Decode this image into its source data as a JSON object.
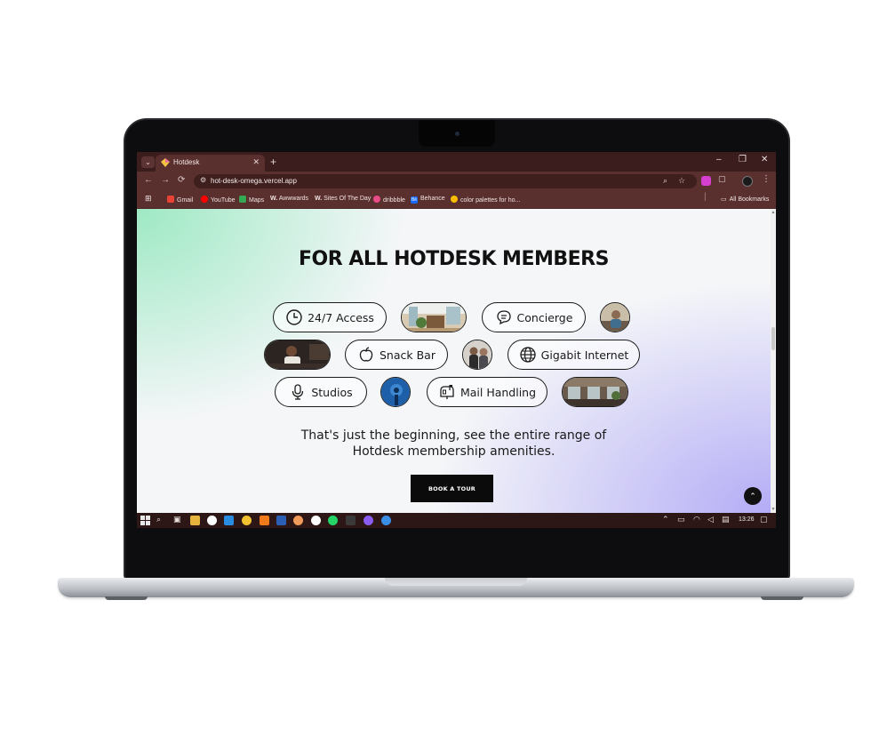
{
  "browser": {
    "tab_title": "Hotdesk",
    "tab_close": "✕",
    "new_tab": "+",
    "tab_search": "⌄",
    "window_controls": {
      "minimize": "–",
      "restore": "❐",
      "close": "✕"
    },
    "nav": {
      "back": "←",
      "forward": "→",
      "reload": "⟳"
    },
    "url": "hot-desk-omega.vercel.app",
    "bookmarks": [
      {
        "label": "Gmail",
        "color": "#ea4335"
      },
      {
        "label": "YouTube",
        "color": "#ff0000"
      },
      {
        "label": "Maps",
        "color": "#34a853"
      },
      {
        "label": "Awwwards",
        "color": "#ffffff"
      },
      {
        "label": "Sites Of The Day",
        "color": "#ffffff"
      },
      {
        "label": "dribbble",
        "color": "#ea4c89"
      },
      {
        "label": "Behance",
        "color": "#1769ff"
      },
      {
        "label": "color palettes for ho...",
        "color": "#fbbc05"
      }
    ],
    "bookmark_prefixes": {
      "awwwards": "W.",
      "sotd": "W.",
      "behance": "Bē"
    },
    "all_bookmarks": "All Bookmarks"
  },
  "page": {
    "headline": "FOR ALL HOTDESK MEMBERS",
    "amenities": {
      "access": "24/7 Access",
      "concierge": "Concierge",
      "snack_bar": "Snack Bar",
      "gigabit_internet": "Gigabit Internet",
      "studios": "Studios",
      "mail_handling": "Mail Handling"
    },
    "subtitle_line1": "That's just the beginning, see the entire range of",
    "subtitle_line2": "Hotdesk membership amenities.",
    "cta_label": "BOOK A TOUR",
    "to_top": "⌃"
  },
  "taskbar": {
    "time": "13:26"
  },
  "colors": {
    "chrome_dark": "#3a1d1c",
    "chrome_mid": "#5a302f",
    "gradient_green": "#9ee9c4",
    "gradient_purple": "#b4acf6",
    "cta_bg": "#0b0b0b"
  }
}
